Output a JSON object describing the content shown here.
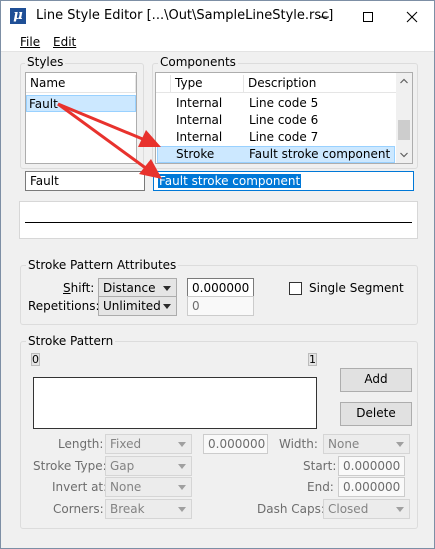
{
  "window": {
    "title": "Line Style Editor [...\\Out\\SampleLineStyle.rsc]",
    "app_icon": "μ",
    "controls": [
      "minimize-icon",
      "maximize-icon",
      "close-icon"
    ]
  },
  "menu": {
    "file": "File",
    "edit": "Edit"
  },
  "styles": {
    "group_label": "Styles",
    "column_header": "Name",
    "items": [
      "Fault"
    ],
    "name_field_value": "Fault"
  },
  "components": {
    "group_label": "Components",
    "columns": {
      "type": "Type",
      "description": "Description"
    },
    "rows": [
      {
        "type": "Internal",
        "description": "Line code 5",
        "selected": false
      },
      {
        "type": "Internal",
        "description": "Line code 6",
        "selected": false
      },
      {
        "type": "Internal",
        "description": "Line code 7",
        "selected": false
      },
      {
        "type": "Stroke",
        "description": "Fault stroke component",
        "selected": true
      }
    ],
    "description_field_value": "Fault stroke component"
  },
  "attributes": {
    "group_label": "Stroke Pattern Attributes",
    "shift_label": "Shift:",
    "shift_option": "Distance",
    "shift_value": "0.000000",
    "repetitions_label": "Repetitions:",
    "repetitions_option": "Unlimited",
    "repetitions_value": "0",
    "single_segment_label": "Single Segment",
    "single_segment_checked": false
  },
  "pattern": {
    "group_label": "Stroke Pattern",
    "start_marker": "0",
    "end_marker": "1",
    "add_label": "Add",
    "delete_label": "Delete",
    "length_label": "Length:",
    "length_option": "Fixed",
    "length_value": "0.000000",
    "width_label": "Width:",
    "width_option": "None",
    "stroke_type_label": "Stroke Type:",
    "stroke_type_option": "Gap",
    "start_label": "Start:",
    "start_value": "0.000000",
    "invert_label": "Invert at:",
    "invert_option": "None",
    "end_label": "End:",
    "end_value": "0.000000",
    "corners_label": "Corners:",
    "corners_option": "Break",
    "dash_caps_label": "Dash Caps:",
    "dash_caps_option": "Closed"
  },
  "colors": {
    "selection": "#cce8ff",
    "highlight": "#0078d7",
    "annotation_arrow": "#e8322d"
  }
}
